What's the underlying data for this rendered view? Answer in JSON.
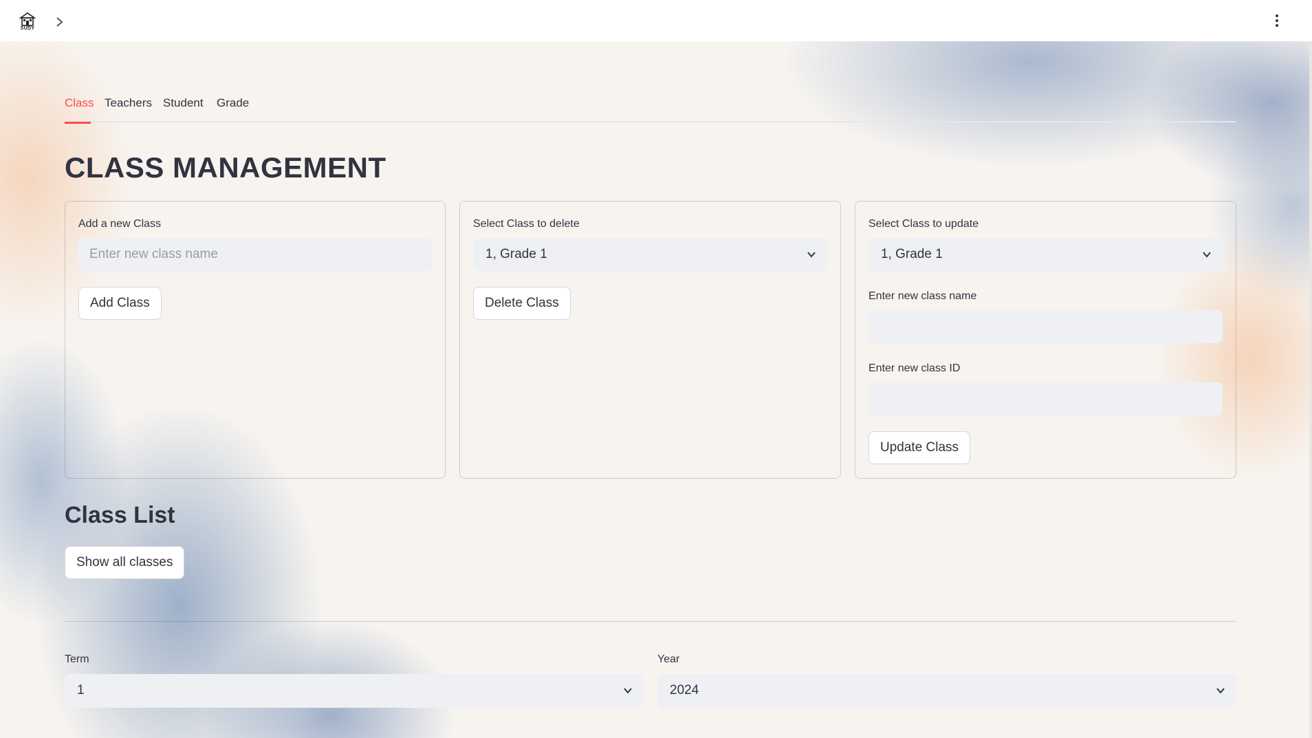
{
  "app": {
    "logo_text": "SUDY"
  },
  "tabs": [
    {
      "label": "Class",
      "active": true
    },
    {
      "label": "Teachers",
      "active": false
    },
    {
      "label": "Student",
      "active": false
    },
    {
      "label": "Grade",
      "active": false
    }
  ],
  "page_title": "CLASS MANAGEMENT",
  "add_card": {
    "label": "Add a new Class",
    "input_placeholder": "Enter new class name",
    "input_value": "",
    "button": "Add Class"
  },
  "delete_card": {
    "label": "Select Class to delete",
    "selected": "1, Grade 1",
    "button": "Delete Class"
  },
  "update_card": {
    "label": "Select Class to update",
    "selected": "1, Grade 1",
    "name_label": "Enter new class name",
    "name_value": "",
    "id_label": "Enter new class ID",
    "id_value": "",
    "button": "Update Class"
  },
  "class_list": {
    "title": "Class List",
    "button": "Show all classes"
  },
  "filters": {
    "term_label": "Term",
    "term_value": "1",
    "year_label": "Year",
    "year_value": "2024"
  },
  "colors": {
    "accent": "#ff4b4b",
    "text": "#31333f",
    "input_bg": "#eef0f4"
  },
  "icons": [
    "app-logo-icon",
    "chevron-right-icon",
    "kebab-menu-icon",
    "chevron-down-icon"
  ]
}
